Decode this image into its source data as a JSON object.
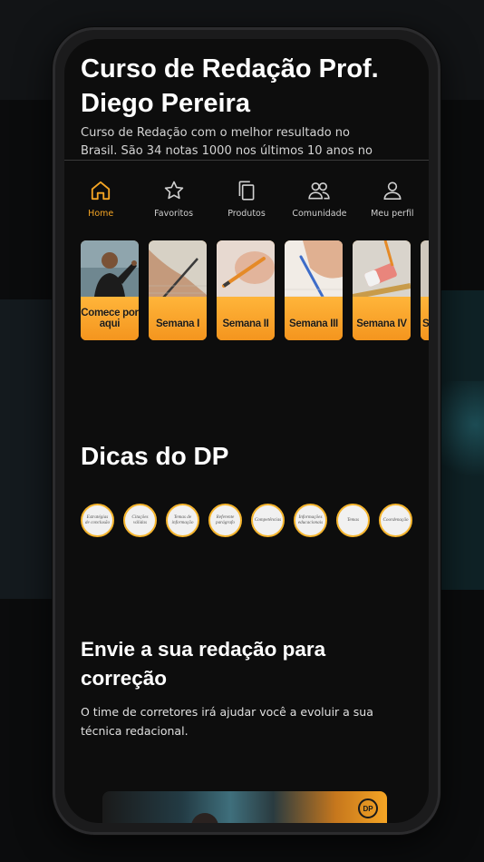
{
  "course": {
    "title": "Curso de Redação Prof. Diego Pereira",
    "description": "Curso de Redação com o melhor resultado no Brasil. São 34 notas 1000 nos últimos 10 anos no"
  },
  "tabs": [
    {
      "label": "Home",
      "icon": "home-icon",
      "active": true
    },
    {
      "label": "Favoritos",
      "icon": "star-icon",
      "active": false
    },
    {
      "label": "Produtos",
      "icon": "copy-icon",
      "active": false
    },
    {
      "label": "Comunidade",
      "icon": "users-icon",
      "active": false
    },
    {
      "label": "Meu perfil",
      "icon": "user-icon",
      "active": false
    }
  ],
  "modules": [
    {
      "label": "Comece por aqui"
    },
    {
      "label": "Semana I"
    },
    {
      "label": "Semana II"
    },
    {
      "label": "Semana III"
    },
    {
      "label": "Semana IV"
    },
    {
      "label": "Se"
    }
  ],
  "dicas": {
    "title": "Dicas do DP",
    "items": [
      {
        "label": "Estratégias de conclusão"
      },
      {
        "label": "Citações válidas"
      },
      {
        "label": "Temas de informação"
      },
      {
        "label": "Referente parágrafo"
      },
      {
        "label": "Competências"
      },
      {
        "label": "Informações educacionais"
      },
      {
        "label": "Temas"
      },
      {
        "label": "Coordenação"
      }
    ]
  },
  "envie": {
    "title": "Envie a sua redação para correção",
    "text": "O time de corretores irá ajudar você a evoluir a sua técnica redacional."
  },
  "banner": {
    "logo": "DP"
  },
  "colors": {
    "accent": "#f5a524",
    "background": "#0d0d0d",
    "text": "#ffffff"
  }
}
